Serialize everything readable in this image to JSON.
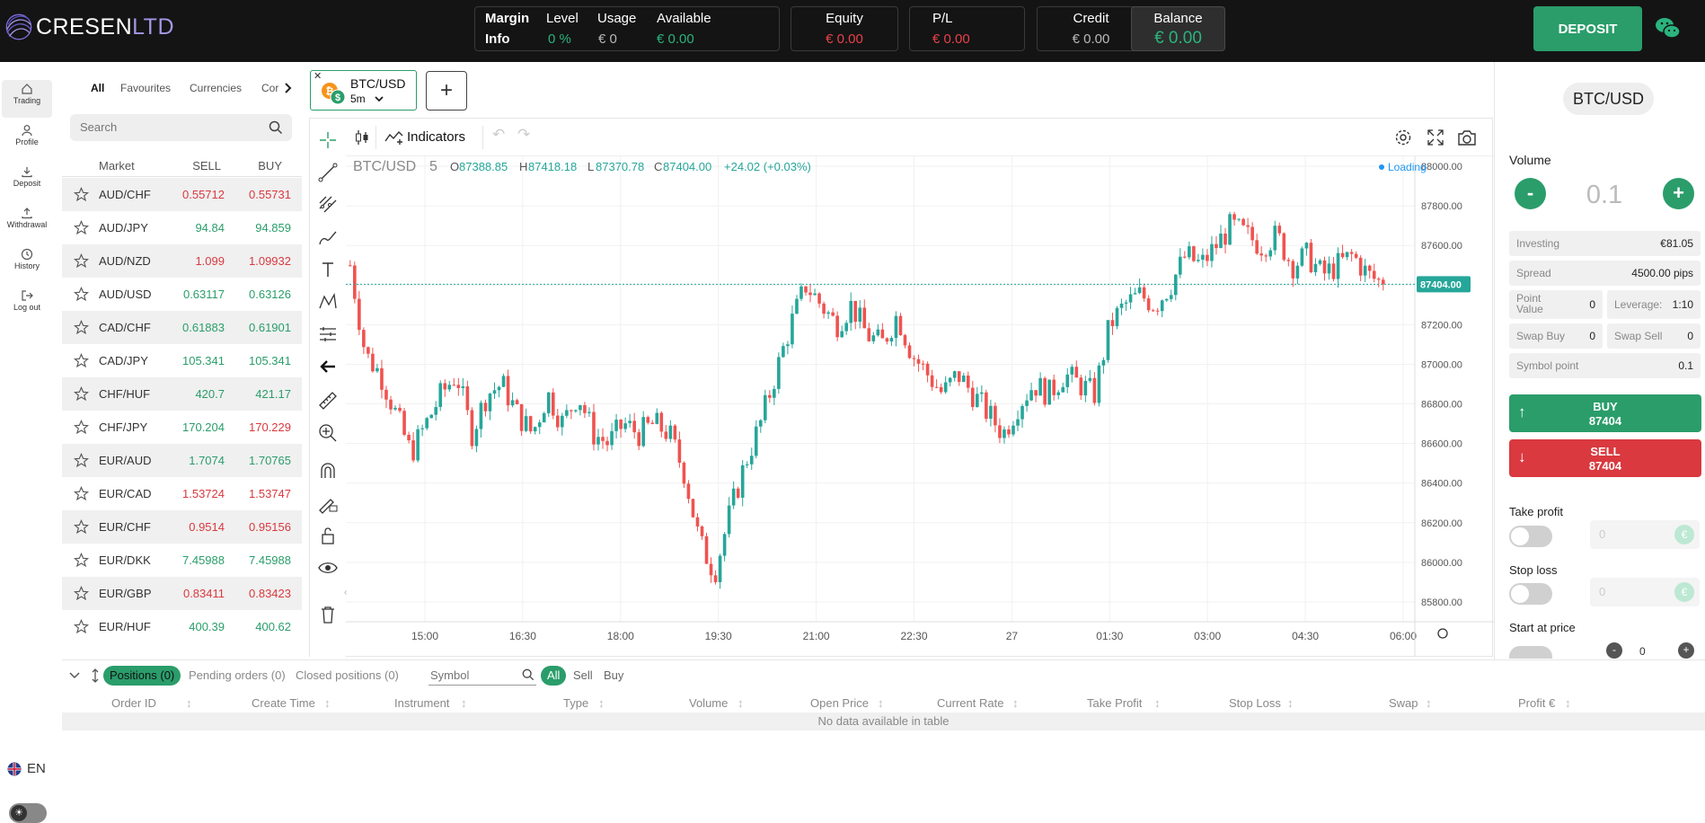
{
  "brand": {
    "name_main": "CRESEN",
    "name_suffix": "LTD"
  },
  "margin_info": {
    "label1": "Margin",
    "label2": "Info",
    "level_label": "Level",
    "level_value": "0 %",
    "usage_label": "Usage",
    "usage_value": "€ 0",
    "available_label": "Available",
    "available_value": "€ 0.00"
  },
  "equity": {
    "label": "Equity",
    "value": "€ 0.00"
  },
  "pl": {
    "label": "P/L",
    "value": "€ 0.00"
  },
  "credit": {
    "label": "Credit",
    "value": "€ 0.00"
  },
  "balance": {
    "label": "Balance",
    "value": "€ 0.00"
  },
  "deposit_button": "DEPOSIT",
  "nav": [
    {
      "label": "Trading",
      "icon": "home-icon"
    },
    {
      "label": "Profile",
      "icon": "user-icon"
    },
    {
      "label": "Deposit",
      "icon": "download-icon"
    },
    {
      "label": "Withdrawal",
      "icon": "upload-icon"
    },
    {
      "label": "History",
      "icon": "clock-icon"
    },
    {
      "label": "Log out",
      "icon": "logout-icon"
    }
  ],
  "language": "EN",
  "market_tabs": [
    "All",
    "Favourites",
    "Currencies",
    "Cor"
  ],
  "search_placeholder": "Search",
  "market_header": {
    "market": "Market",
    "sell": "SELL",
    "buy": "BUY"
  },
  "markets": [
    {
      "name": "AUD/CHF",
      "sell": "0.55712",
      "buy": "0.55731",
      "color": "#d9393f"
    },
    {
      "name": "AUD/JPY",
      "sell": "94.84",
      "buy": "94.859",
      "color": "#2a9d6a"
    },
    {
      "name": "AUD/NZD",
      "sell": "1.099",
      "buy": "1.09932",
      "color": "#d9393f"
    },
    {
      "name": "AUD/USD",
      "sell": "0.63117",
      "buy": "0.63126",
      "color": "#2a9d6a"
    },
    {
      "name": "CAD/CHF",
      "sell": "0.61883",
      "buy": "0.61901",
      "color": "#2a9d6a"
    },
    {
      "name": "CAD/JPY",
      "sell": "105.341",
      "buy": "105.341",
      "color": "#2a9d6a"
    },
    {
      "name": "CHF/HUF",
      "sell": "420.7",
      "buy": "421.17",
      "color": "#2a9d6a"
    },
    {
      "name": "CHF/JPY",
      "sell": "170.204",
      "buy": "170.229",
      "color": "#2a9d6a",
      "buy_color": "#d9393f"
    },
    {
      "name": "EUR/AUD",
      "sell": "1.7074",
      "buy": "1.70765",
      "color": "#2a9d6a"
    },
    {
      "name": "EUR/CAD",
      "sell": "1.53724",
      "buy": "1.53747",
      "color": "#d9393f"
    },
    {
      "name": "EUR/CHF",
      "sell": "0.9514",
      "buy": "0.95156",
      "color": "#d9393f"
    },
    {
      "name": "EUR/DKK",
      "sell": "7.45988",
      "buy": "7.45988",
      "color": "#2a9d6a"
    },
    {
      "name": "EUR/GBP",
      "sell": "0.83411",
      "buy": "0.83423",
      "color": "#d9393f"
    },
    {
      "name": "EUR/HUF",
      "sell": "400.39",
      "buy": "400.62",
      "color": "#2a9d6a"
    }
  ],
  "symbol_tab": {
    "symbol": "BTC/USD",
    "interval": "5m"
  },
  "toolbar": {
    "indicators": "Indicators"
  },
  "chart_data": {
    "type": "candlestick",
    "symbol": "BTC/USD",
    "interval": "5",
    "ohlc_label": {
      "o_prefix": "O",
      "o": "87388.85",
      "h_prefix": "H",
      "h": "87418.18",
      "l_prefix": "L",
      "l": "87370.78",
      "c_prefix": "C",
      "c": "87404.00",
      "change": "+24.02 (+0.03%)"
    },
    "loading_label": "Loading",
    "last_price": "87404.00",
    "y_ticks": [
      "88000.00",
      "87800.00",
      "87600.00",
      "87400.00",
      "87200.00",
      "87000.00",
      "86800.00",
      "86600.00",
      "86400.00",
      "86200.00",
      "86000.00",
      "85800.00"
    ],
    "x_ticks": [
      "15:00",
      "16:30",
      "18:00",
      "19:30",
      "21:00",
      "22:30",
      "27",
      "01:30",
      "03:00",
      "04:30",
      "06:00"
    ],
    "ylim": [
      85700,
      88050
    ],
    "close_path": [
      87500,
      87050,
      86950,
      86750,
      86550,
      86700,
      86850,
      86950,
      86650,
      86850,
      86900,
      86750,
      86650,
      86850,
      86700,
      86850,
      86650,
      86600,
      86700,
      86650,
      86700,
      86650,
      86450,
      86100,
      85950,
      86250,
      86500,
      86700,
      86950,
      87200,
      87400,
      87300,
      87200,
      87300,
      87150,
      87100,
      87250,
      87050,
      86950,
      86850,
      86950,
      86850,
      86750,
      86650,
      86800,
      86900,
      86850,
      86950,
      86900,
      86850,
      87200,
      87300,
      87350,
      87300,
      87400,
      87550,
      87500,
      87600,
      87700,
      87650,
      87600,
      87650,
      87500,
      87550,
      87450,
      87500,
      87550,
      87450,
      87404
    ]
  },
  "right_panel": {
    "pair": "BTC/USD",
    "volume_label": "Volume",
    "volume_value": "0.1",
    "investing_label": "Investing",
    "investing_value": "€81.05",
    "spread_label": "Spread",
    "spread_value": "4500.00 pips",
    "point_value_label": "Point Value",
    "point_value": "0",
    "leverage_label": "Leverage:",
    "leverage_value": "1:10",
    "swap_buy_label": "Swap Buy",
    "swap_buy_value": "0",
    "swap_sell_label": "Swap Sell",
    "swap_sell_value": "0",
    "symbol_point_label": "Symbol point",
    "symbol_point_value": "0.1",
    "buy_label": "BUY",
    "buy_price": "87404",
    "sell_label": "SELL",
    "sell_price": "87404",
    "take_profit_label": "Take profit",
    "take_profit_value": "0",
    "take_profit_unit": "€",
    "stop_loss_label": "Stop loss",
    "stop_loss_value": "0",
    "stop_loss_unit": "€",
    "start_price_label": "Start at price",
    "start_price_value": "0"
  },
  "bottom": {
    "tabs": [
      "Positions (0)",
      "Pending orders (0)",
      "Closed positions (0)"
    ],
    "symbol_placeholder": "Symbol",
    "filters": [
      "All",
      "Sell",
      "Buy"
    ],
    "columns": [
      "Order ID",
      "Create Time",
      "Instrument",
      "Type",
      "Volume",
      "Open Price",
      "Current Rate",
      "Take Profit",
      "Stop Loss",
      "Swap",
      "Profit €"
    ],
    "empty": "No data available in table"
  }
}
